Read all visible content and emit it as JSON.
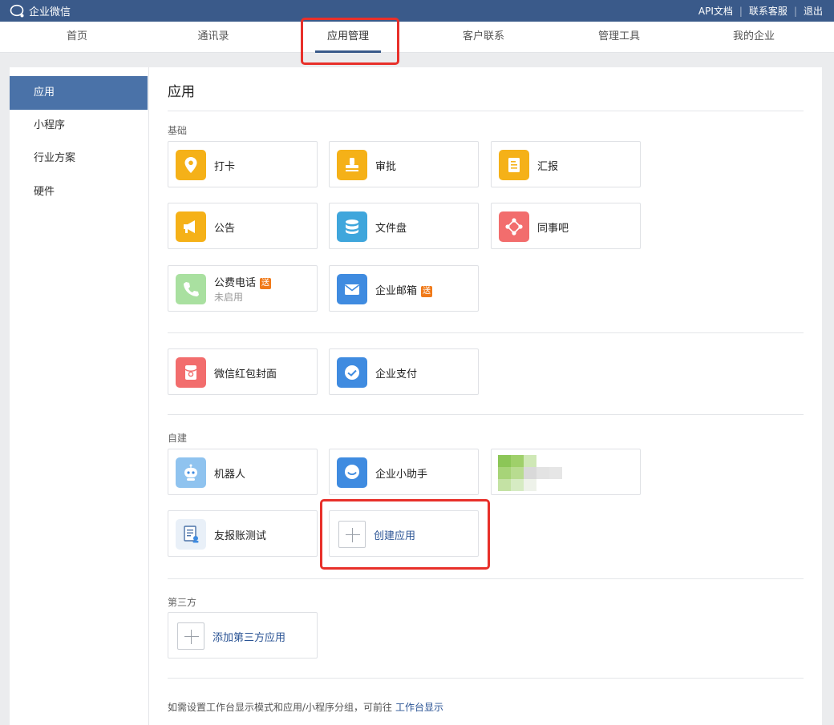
{
  "topbar": {
    "logo_text": "企业微信",
    "links": [
      "API文档",
      "联系客服",
      "退出"
    ],
    "separator": "|"
  },
  "nav": {
    "items": [
      "首页",
      "通讯录",
      "应用管理",
      "客户联系",
      "管理工具",
      "我的企业"
    ],
    "active_index": 2
  },
  "sidebar": {
    "items": [
      "应用",
      "小程序",
      "行业方案",
      "硬件"
    ],
    "active_index": 0
  },
  "main": {
    "title": "应用",
    "sections": {
      "basic_label": "基础",
      "custom_label": "自建",
      "third_party_label": "第三方"
    },
    "basic_apps": [
      {
        "name": "打卡",
        "icon": "location-pin-icon",
        "color": "#f5b118"
      },
      {
        "name": "审批",
        "icon": "stamp-icon",
        "color": "#f5b118"
      },
      {
        "name": "汇报",
        "icon": "report-document-icon",
        "color": "#f5b118"
      },
      {
        "name": "公告",
        "icon": "megaphone-icon",
        "color": "#f5b118"
      },
      {
        "name": "文件盘",
        "icon": "database-icon",
        "color": "#3fa6dc"
      },
      {
        "name": "同事吧",
        "icon": "network-icon",
        "color": "#f26d6d"
      },
      {
        "name": "公费电话",
        "icon": "phone-icon",
        "color": "#a9e0a0",
        "badge": "送",
        "status": "未启用"
      },
      {
        "name": "企业邮箱",
        "icon": "mail-icon",
        "color": "#3f8be0",
        "badge": "送"
      }
    ],
    "extra_apps": [
      {
        "name": "微信红包封面",
        "icon": "red-envelope-icon",
        "color": "#f26d6d"
      },
      {
        "name": "企业支付",
        "icon": "payment-check-icon",
        "color": "#3f8be0"
      }
    ],
    "custom_apps": [
      {
        "name": "机器人",
        "icon": "robot-icon",
        "color": "#8fc3ef"
      },
      {
        "name": "企业小助手",
        "icon": "chat-bubble-icon",
        "color": "#3f8be0"
      },
      {
        "name": "",
        "icon": "pixelated-app-icon",
        "color": "#8cc657"
      },
      {
        "name": "友报账测试",
        "icon": "expense-form-icon",
        "color": "#e9f0f8"
      }
    ],
    "create_app_label": "创建应用",
    "add_third_party_label": "添加第三方应用",
    "footer_text": "如需设置工作台显示模式和应用/小程序分组，可前往",
    "footer_link": "工作台显示"
  }
}
